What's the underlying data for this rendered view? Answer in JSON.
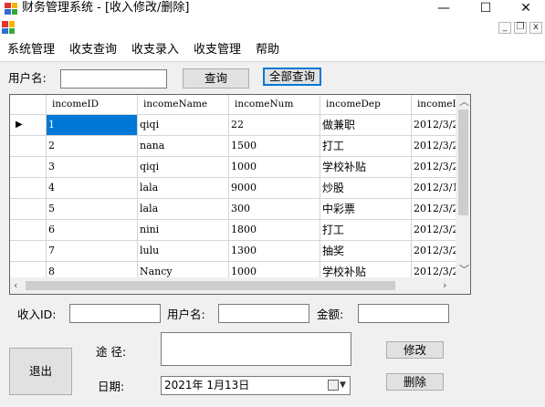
{
  "window": {
    "title": "财务管理系统 - [收入修改/删除]",
    "minimize_glyph": "—",
    "maximize_glyph": "☐",
    "close_glyph": "✕",
    "icon": "app-icon"
  },
  "mdi": {
    "minimize_glyph": "_",
    "restore_glyph": "❐",
    "close_glyph": "x"
  },
  "menu": {
    "items": [
      "系统管理",
      "收支查询",
      "收支录入",
      "收支管理",
      "帮助"
    ]
  },
  "search": {
    "label": "用户名:",
    "value": "",
    "query_button": "查询",
    "query_all_button": "全部查询"
  },
  "table": {
    "columns": [
      "incomeID",
      "incomeName",
      "incomeNum",
      "incomeDep",
      "incomeD"
    ],
    "rows": [
      [
        "1",
        "qiqi",
        "22",
        "做兼职",
        "2012/3/2"
      ],
      [
        "2",
        "nana",
        "1500",
        "打工",
        "2012/3/2"
      ],
      [
        "3",
        "qiqi",
        "1000",
        "学校补贴",
        "2012/3/2"
      ],
      [
        "4",
        "lala",
        "9000",
        "炒股",
        "2012/3/1"
      ],
      [
        "5",
        "lala",
        "300",
        "中彩票",
        "2012/3/2"
      ],
      [
        "6",
        "nini",
        "1800",
        "打工",
        "2012/3/2"
      ],
      [
        "7",
        "lulu",
        "1300",
        "抽奖",
        "2012/3/2"
      ],
      [
        "8",
        "Nancy",
        "1000",
        "学校补贴",
        "2012/3/2"
      ]
    ],
    "current_row_marker": "▶",
    "selected_row": 1
  },
  "form": {
    "income_id_label": "收入ID:",
    "income_id_value": "",
    "username_label": "用户名:",
    "username_value": "",
    "amount_label": "金额:",
    "amount_value": "",
    "source_label": "途 径:",
    "source_value": "",
    "date_label": "日期:",
    "date_value": "2021年  1月13日",
    "modify_button": "修改",
    "delete_button": "删除",
    "exit_button": "退出"
  }
}
